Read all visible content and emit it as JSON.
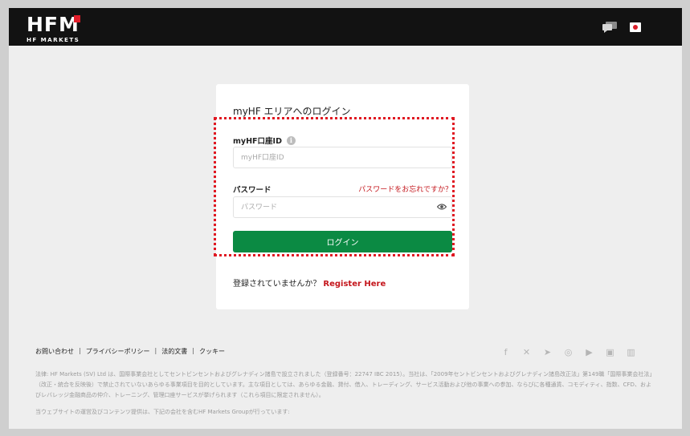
{
  "header": {
    "logo_text": "HFM",
    "logo_sub": "HF MARKETS"
  },
  "login": {
    "title": "myHF エリアへのログイン",
    "account_label": "myHF口座ID",
    "account_placeholder": "myHF口座ID",
    "password_label": "パスワード",
    "forgot_link": "パスワードをお忘れですか？",
    "password_placeholder": "パスワード",
    "login_button": "ログイン",
    "register_prompt": "登録されていませんか？",
    "register_link": "Register Here"
  },
  "footer": {
    "links": [
      "お問い合わせ",
      "プライバシーポリシー",
      "法的文書",
      "クッキー"
    ],
    "separator": "|",
    "socials": [
      "facebook-icon",
      "x-icon",
      "telegram-icon",
      "instagram-icon",
      "youtube-icon",
      "linkedin-icon",
      "chart-icon"
    ],
    "legal_text": "法律: HF Markets (SV) Ltd は、国際事業会社としてセントビンセントおよびグレナディン諸島で設立されました（登録番号：22747 IBC 2015）。当社は、「2009年セントビンセントおよびグレナディン諸島改正法」第149職「国際事業会社法」（改正・統合を反映後）で禁止されていないあらゆる事業項目を目的としています。主な項目としては、あらゆる金融、貸付、借入、トレーディング、サービス活動および他の事業への参加、ならびに各種通貨、コモディティ、指数、CFD、およびレバレッジ金融商品の仲介、トレーニング、管理口座サービスが挙げられます（これら項目に限定されません）。",
    "provider_text": "当ウェブサイトの運営及びコンテンツ提供は、下記の会社を含むHF Markets Groupが行っています:"
  },
  "colors": {
    "accent_red": "#c4161c",
    "button_green": "#0b8a43",
    "header_black": "#121212"
  }
}
